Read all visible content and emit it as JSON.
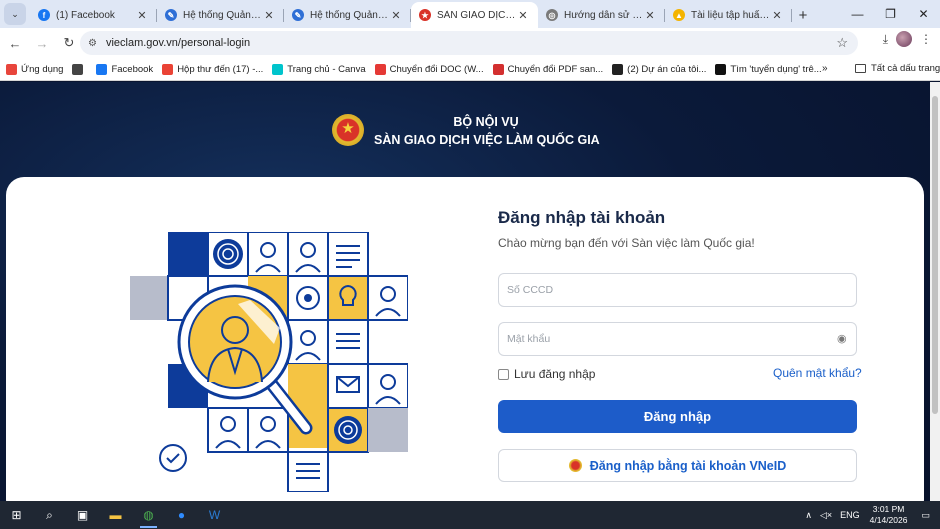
{
  "browser": {
    "tabs": [
      {
        "title": "(1) Facebook",
        "icon": "facebook-icon",
        "color": "#1877f2",
        "glyph": "f"
      },
      {
        "title": "Hệ thống Quản lý văn",
        "icon": "quill-icon",
        "color": "#2f6fd6",
        "glyph": "✎"
      },
      {
        "title": "Hệ thống Quản lý văn",
        "icon": "quill-icon",
        "color": "#2f6fd6",
        "glyph": "✎"
      },
      {
        "title": "SÀN GIAO DỊCH VIỆC",
        "icon": "emblem-icon",
        "color": "#d93228",
        "glyph": "★",
        "active": true
      },
      {
        "title": "Hướng dẫn sử dụng",
        "icon": "globe-icon",
        "color": "#7a7a7a",
        "glyph": "◎"
      },
      {
        "title": "Tài liệu tập huấn hệ t",
        "icon": "drive-icon",
        "color": "#f4b400",
        "glyph": "▲"
      }
    ],
    "url": "vieclam.gov.vn/personal-login",
    "bookmarks": [
      {
        "label": "Ứng dụng",
        "icon": "apps-grid-icon",
        "color": "#e8453c"
      },
      {
        "label": "",
        "icon": "tab-groups-icon",
        "color": "#444444"
      },
      {
        "label": "Facebook",
        "icon": "facebook-icon",
        "color": "#1877f2"
      },
      {
        "label": "Hộp thư đến (17) -...",
        "icon": "gmail-icon",
        "color": "#ea4335"
      },
      {
        "label": "Trang chủ - Canva",
        "icon": "canva-icon",
        "color": "#00c4cc"
      },
      {
        "label": "Chuyển đổi DOC (W...",
        "icon": "convert-icon",
        "color": "#e53935"
      },
      {
        "label": "Chuyển đổi PDF san...",
        "icon": "heart-icon",
        "color": "#d32f2f"
      },
      {
        "label": "(2) Dự án của tôi...",
        "icon": "project-icon",
        "color": "#222222"
      },
      {
        "label": "Tìm 'tuyển dụng' trê...",
        "icon": "tiktok-icon",
        "color": "#111111"
      }
    ],
    "all_bookmarks": "Tất cả dấu trang"
  },
  "header": {
    "org_line1": "BỘ NỘI VỤ",
    "org_line2": "SÀN GIAO DỊCH VIỆC LÀM QUỐC GIA"
  },
  "login": {
    "title": "Đăng nhập tài khoản",
    "subtitle": "Chào mừng bạn đến với Sàn việc làm Quốc gia!",
    "id_placeholder": "Số CCCD",
    "password_placeholder": "Mật khẩu",
    "remember_label": "Lưu đăng nhập",
    "forgot_label": "Quên mật khẩu?",
    "login_button": "Đăng nhập",
    "vneid_button": "Đăng nhập bằng tài khoản VNeID"
  },
  "taskbar": {
    "language": "ENG",
    "time": "3:01 PM",
    "date": "4/14/2026"
  }
}
